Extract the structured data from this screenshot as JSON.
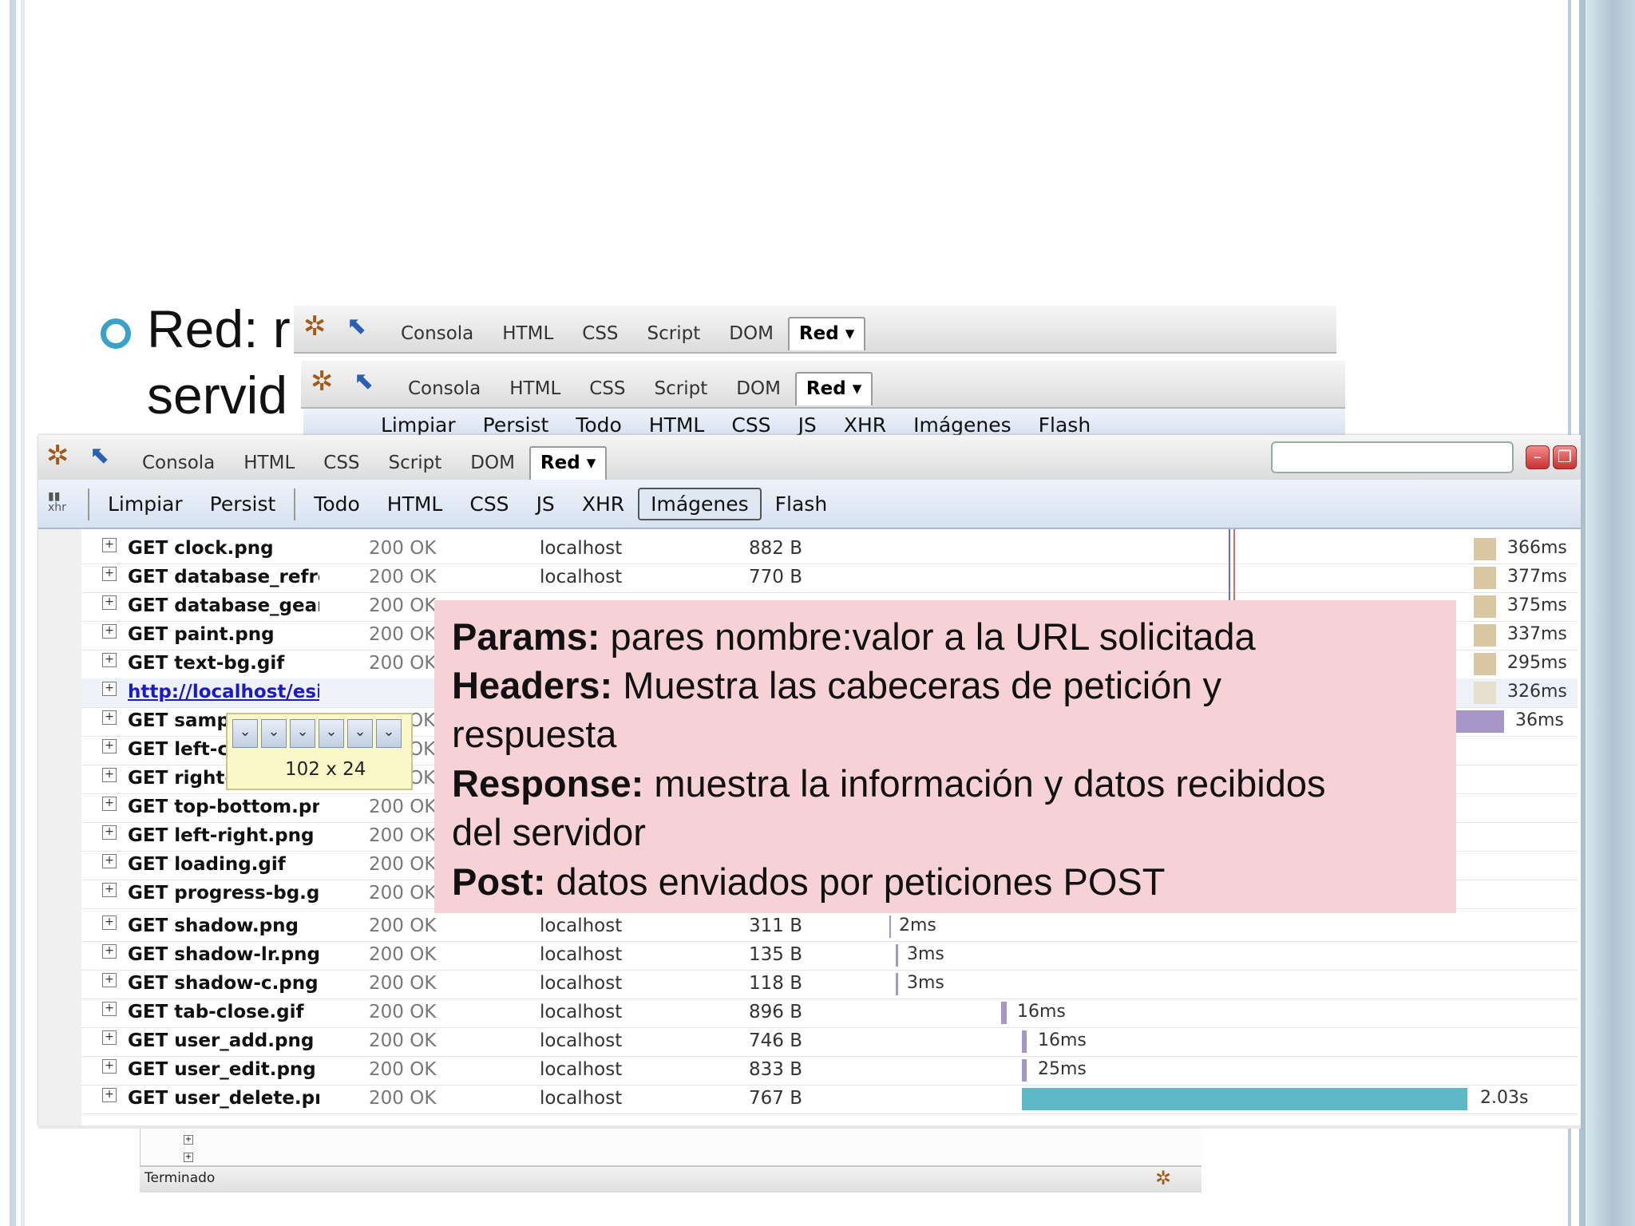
{
  "slide": {
    "line1": "Red: r",
    "line2": "servid"
  },
  "toolbar": {
    "tabs": [
      "Consola",
      "HTML",
      "CSS",
      "Script",
      "DOM"
    ],
    "selected_tab": "Red ▾"
  },
  "subbar_back": {
    "items": [
      "Limpiar",
      "Persist",
      "Todo",
      "HTML",
      "CSS",
      "JS",
      "XHR",
      "Imágenes",
      "Flash"
    ]
  },
  "subbar": {
    "items": [
      "Limpiar",
      "Persist",
      "Todo",
      "HTML",
      "CSS",
      "JS",
      "XHR",
      "Imágenes",
      "Flash"
    ],
    "selected": "Imágenes"
  },
  "requests": [
    {
      "file": "GET clock.png",
      "status": "200 OK",
      "domain": "localhost",
      "size": "882 B",
      "time": "366ms"
    },
    {
      "file": "GET database_refres",
      "status": "200 OK",
      "domain": "localhost",
      "size": "770 B",
      "time": "377ms"
    },
    {
      "file": "GET database_gear.p",
      "status": "200 OK",
      "domain": "",
      "size": "",
      "time": "375ms"
    },
    {
      "file": "GET paint.png",
      "status": "200 OK",
      "domain": "",
      "size": "",
      "time": "337ms"
    },
    {
      "file": "GET text-bg.gif",
      "status": "200 OK",
      "domain": "",
      "size": "",
      "time": "295ms"
    },
    {
      "file": "http://localhost/esipv/js/ext/r",
      "status": "",
      "domain": "",
      "size": "",
      "time": "326ms"
    },
    {
      "file": "GET sampl",
      "status": "OK",
      "domain": "",
      "size": "",
      "time": "36ms"
    },
    {
      "file": "GET left-cc",
      "status": "OK",
      "domain": "",
      "size": "",
      "time": ""
    },
    {
      "file": "GET right-c",
      "status": "OK",
      "domain": "",
      "size": "",
      "time": ""
    },
    {
      "file": "GET top-bottom.png",
      "status": "200 OK",
      "domain": "",
      "size": "",
      "time": ""
    },
    {
      "file": "GET left-right.png",
      "status": "200 OK",
      "domain": "",
      "size": "",
      "time": ""
    },
    {
      "file": "GET loading.gif",
      "status": "200 OK",
      "domain": "",
      "size": "",
      "time": ""
    },
    {
      "file": "GET progress-bg.gif",
      "status": "200 OK",
      "domain": "",
      "size": "",
      "time": ""
    },
    {
      "file": "GET shadow.png",
      "status": "200 OK",
      "domain": "localhost",
      "size": "311 B",
      "time": "2ms"
    },
    {
      "file": "GET shadow-lr.png",
      "status": "200 OK",
      "domain": "localhost",
      "size": "135 B",
      "time": "3ms"
    },
    {
      "file": "GET shadow-c.png",
      "status": "200 OK",
      "domain": "localhost",
      "size": "118 B",
      "time": "3ms"
    },
    {
      "file": "GET tab-close.gif",
      "status": "200 OK",
      "domain": "localhost",
      "size": "896 B",
      "time": "16ms"
    },
    {
      "file": "GET user_add.png",
      "status": "200 OK",
      "domain": "localhost",
      "size": "746 B",
      "time": "16ms"
    },
    {
      "file": "GET user_edit.png",
      "status": "200 OK",
      "domain": "localhost",
      "size": "833 B",
      "time": "25ms"
    },
    {
      "file": "GET user_delete.png",
      "status": "200 OK",
      "domain": "localhost",
      "size": "767 B",
      "time": "2.03s"
    }
  ],
  "tooltip": {
    "size_label": "102 x 24"
  },
  "overlay": {
    "lines": [
      {
        "term": "Params:",
        "text": " pares nombre:valor a la URL solicitada"
      },
      {
        "term": "Headers:",
        "text": " Muestra las cabeceras de petición y"
      },
      {
        "term": "",
        "text": "respuesta"
      },
      {
        "term": "Response:",
        "text": " muestra la información y datos recibidos"
      },
      {
        "term": "",
        "text": "del servidor"
      },
      {
        "term": "Post:",
        "text": " datos enviados por peticiones POST"
      }
    ]
  },
  "statusbar": {
    "text": "Terminado"
  },
  "colors": {
    "overlay_bg": "#f6d1d6",
    "bullet": "#3aa2c8",
    "timeline_tan": "#d9c6a2",
    "timeline_purple": "#a696c8",
    "timeline_teal": "#5eb9c6"
  }
}
